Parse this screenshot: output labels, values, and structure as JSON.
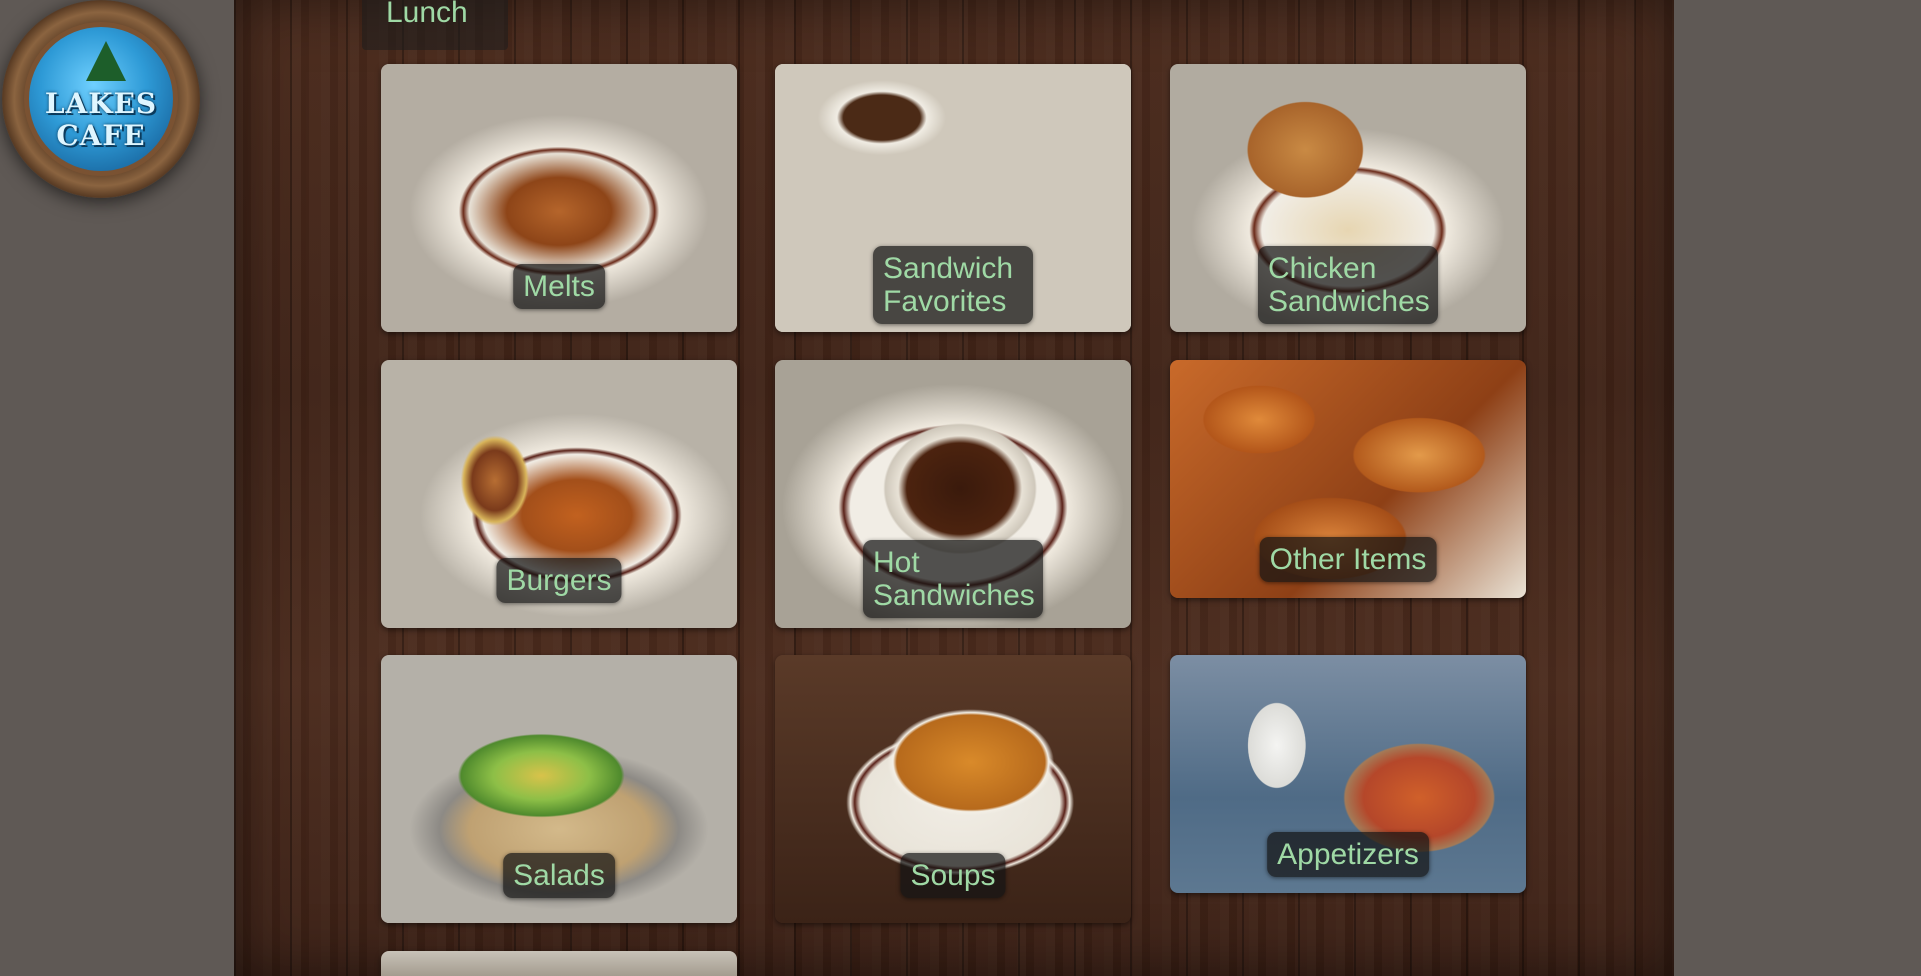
{
  "logo": {
    "line1": "LAKES",
    "line2": "CAFE"
  },
  "section": {
    "title": "Lunch"
  },
  "categories": [
    {
      "label": "Melts"
    },
    {
      "label": "Sandwich Favorites"
    },
    {
      "label": "Chicken Sandwiches"
    },
    {
      "label": "Burgers"
    },
    {
      "label": "Hot Sandwiches"
    },
    {
      "label": "Other Items"
    },
    {
      "label": "Salads"
    },
    {
      "label": "Soups"
    },
    {
      "label": "Appetizers"
    }
  ]
}
